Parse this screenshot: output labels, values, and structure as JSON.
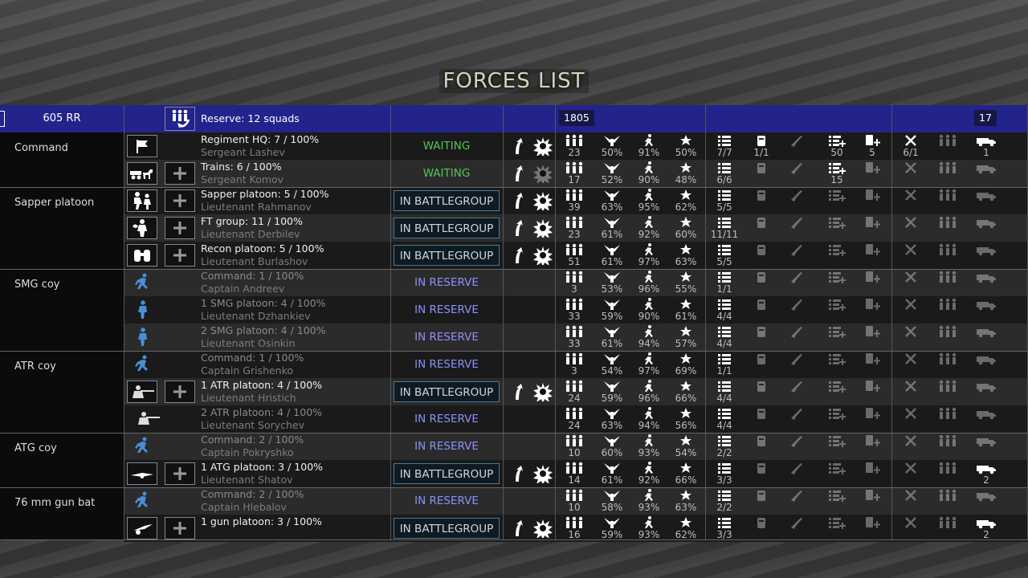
{
  "screen_title": "FORCES LIST",
  "header": {
    "unit_name": "605 RR",
    "reserve_text": "Reserve: 12  squads",
    "points": "1805",
    "count": "17"
  },
  "colors": {
    "header_bg": "#23238c",
    "in_battlegroup_border": "#4d7a96",
    "in_reserve": "#8f8fff",
    "waiting": "#55c455"
  },
  "groups": [
    {
      "label": "Command"
    },
    {
      "label": "Sapper platoon"
    },
    {
      "label": "SMG coy"
    },
    {
      "label": "ATR coy"
    },
    {
      "label": "ATG coy"
    },
    {
      "label": "76 mm gun bat"
    }
  ],
  "rows": [
    {
      "name": "Regiment HQ: 7 / 100%",
      "leader": "Sergeant Lashev",
      "status": "WAITING",
      "men": "23",
      "exp": "50%",
      "mor": "91%",
      "fat": "50%",
      "ammo": "7/7",
      "c2": "1/1",
      "c4": "50",
      "c5": "5",
      "c6": "6/1",
      "c8": "1"
    },
    {
      "name": "Trains: 6 / 100%",
      "leader": "Sergeant Komov",
      "status": "WAITING",
      "men": "17",
      "exp": "52%",
      "mor": "90%",
      "fat": "48%",
      "ammo": "6/6",
      "c4": "15"
    },
    {
      "name": "Sapper platoon: 5 / 100%",
      "leader": "Lieutenant Rahmanov",
      "status": "IN BATTLEGROUP",
      "men": "39",
      "exp": "63%",
      "mor": "95%",
      "fat": "62%",
      "ammo": "5/5"
    },
    {
      "name": "FT group: 11 / 100%",
      "leader": "Lieutenant Derbilev",
      "status": "IN BATTLEGROUP",
      "men": "23",
      "exp": "61%",
      "mor": "92%",
      "fat": "60%",
      "ammo": "11/11"
    },
    {
      "name": "Recon platoon: 5 / 100%",
      "leader": "Lieutenant Burlashov",
      "status": "IN BATTLEGROUP",
      "men": "51",
      "exp": "61%",
      "mor": "97%",
      "fat": "63%",
      "ammo": "5/5"
    },
    {
      "name": "Command: 1 / 100%",
      "leader": "Captain Andreev",
      "status": "IN RESERVE",
      "men": "3",
      "exp": "53%",
      "mor": "96%",
      "fat": "55%",
      "ammo": "1/1"
    },
    {
      "name": "1 SMG platoon: 4 / 100%",
      "leader": "Lieutenant Dzhankiev",
      "status": "IN RESERVE",
      "men": "33",
      "exp": "59%",
      "mor": "90%",
      "fat": "61%",
      "ammo": "4/4"
    },
    {
      "name": "2 SMG platoon: 4 / 100%",
      "leader": "Lieutenant Osinkin",
      "status": "IN RESERVE",
      "men": "33",
      "exp": "61%",
      "mor": "94%",
      "fat": "57%",
      "ammo": "4/4"
    },
    {
      "name": "Command: 1 / 100%",
      "leader": "Captain Grishenko",
      "status": "IN RESERVE",
      "men": "3",
      "exp": "54%",
      "mor": "97%",
      "fat": "69%",
      "ammo": "1/1"
    },
    {
      "name": "1 ATR platoon: 4 / 100%",
      "leader": "Lieutenant Hristich",
      "status": "IN BATTLEGROUP",
      "men": "24",
      "exp": "59%",
      "mor": "96%",
      "fat": "66%",
      "ammo": "4/4"
    },
    {
      "name": "2 ATR platoon: 4 / 100%",
      "leader": "Lieutenant Sorychev",
      "status": "IN RESERVE",
      "men": "24",
      "exp": "63%",
      "mor": "94%",
      "fat": "56%",
      "ammo": "4/4"
    },
    {
      "name": "Command: 2 / 100%",
      "leader": "Captain Pokryshko",
      "status": "IN RESERVE",
      "men": "10",
      "exp": "60%",
      "mor": "93%",
      "fat": "54%",
      "ammo": "2/2"
    },
    {
      "name": "1 ATG platoon: 3 / 100%",
      "leader": "Lieutenant Shatov",
      "status": "IN BATTLEGROUP",
      "men": "14",
      "exp": "61%",
      "mor": "92%",
      "fat": "66%",
      "ammo": "3/3",
      "c8": "2"
    },
    {
      "name": "Command: 2 / 100%",
      "leader": "Captain Hlebalov",
      "status": "IN RESERVE",
      "men": "10",
      "exp": "58%",
      "mor": "93%",
      "fat": "63%",
      "ammo": "2/2"
    },
    {
      "name": "1 gun platoon: 3 / 100%",
      "leader": "",
      "status": "IN BATTLEGROUP",
      "men": "16",
      "exp": "59%",
      "mor": "93%",
      "fat": "62%",
      "ammo": "3/3",
      "c8": "2"
    }
  ]
}
